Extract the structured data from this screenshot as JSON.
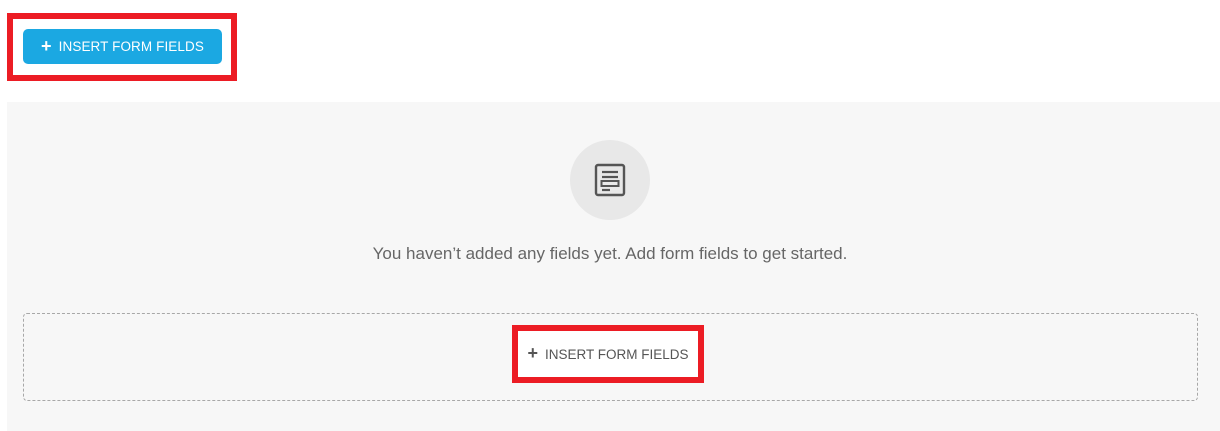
{
  "header": {
    "insert_button": {
      "label": "INSERT FORM FIELDS",
      "icon": "plus-icon",
      "color": "#1ba8e2"
    }
  },
  "empty_state": {
    "icon": "document-icon",
    "message": "You haven’t added any fields yet. Add form fields to get started."
  },
  "dropzone": {
    "insert_button": {
      "label": "INSERT FORM FIELDS",
      "icon": "plus-icon"
    }
  },
  "colors": {
    "highlight": "#ec1c24",
    "background": "#f7f7f7"
  }
}
